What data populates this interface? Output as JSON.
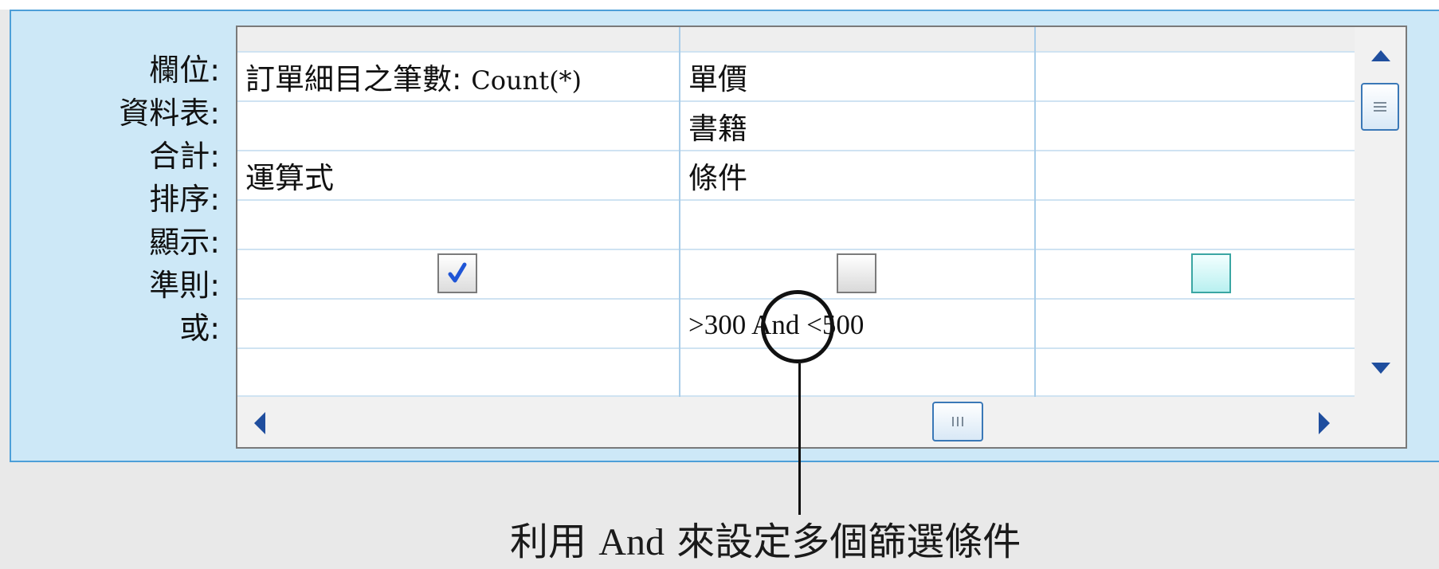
{
  "row_labels": [
    "欄位:",
    "資料表:",
    "合計:",
    "排序:",
    "顯示:",
    "準則:",
    "或:"
  ],
  "columns": [
    {
      "field_prefix": "訂單細目之筆數: ",
      "field_expr": "Count(*)",
      "table": "",
      "total": "運算式",
      "sort": "",
      "show": true,
      "criteria": "",
      "or": ""
    },
    {
      "field_prefix": "單價",
      "field_expr": "",
      "table": "書籍",
      "total": "條件",
      "sort": "",
      "show": false,
      "criteria": ">300 And <500",
      "or": ""
    },
    {
      "field_prefix": "",
      "field_expr": "",
      "table": "",
      "total": "",
      "sort": "",
      "show": false,
      "criteria": "",
      "or": ""
    }
  ],
  "criteria_parts": {
    "left": ">300",
    "mid": "And",
    "right": "<500"
  },
  "annotation": {
    "caption_a": "利用",
    "caption_b": "And",
    "caption_c": "來設定多個篩選條件"
  },
  "icons": {
    "vscroll_up": "triangle-up-icon",
    "vscroll_down": "triangle-down-icon",
    "hscroll_left": "triangle-left-icon",
    "hscroll_right": "triangle-right-icon",
    "checkmark": "checkmark-icon"
  },
  "colors": {
    "pane_bg": "#cde8f7",
    "pane_border": "#4d9fd8",
    "arrow_blue": "#1f4e9e",
    "check_blue": "#1f55d6",
    "thumb_border": "#3a78b7"
  }
}
